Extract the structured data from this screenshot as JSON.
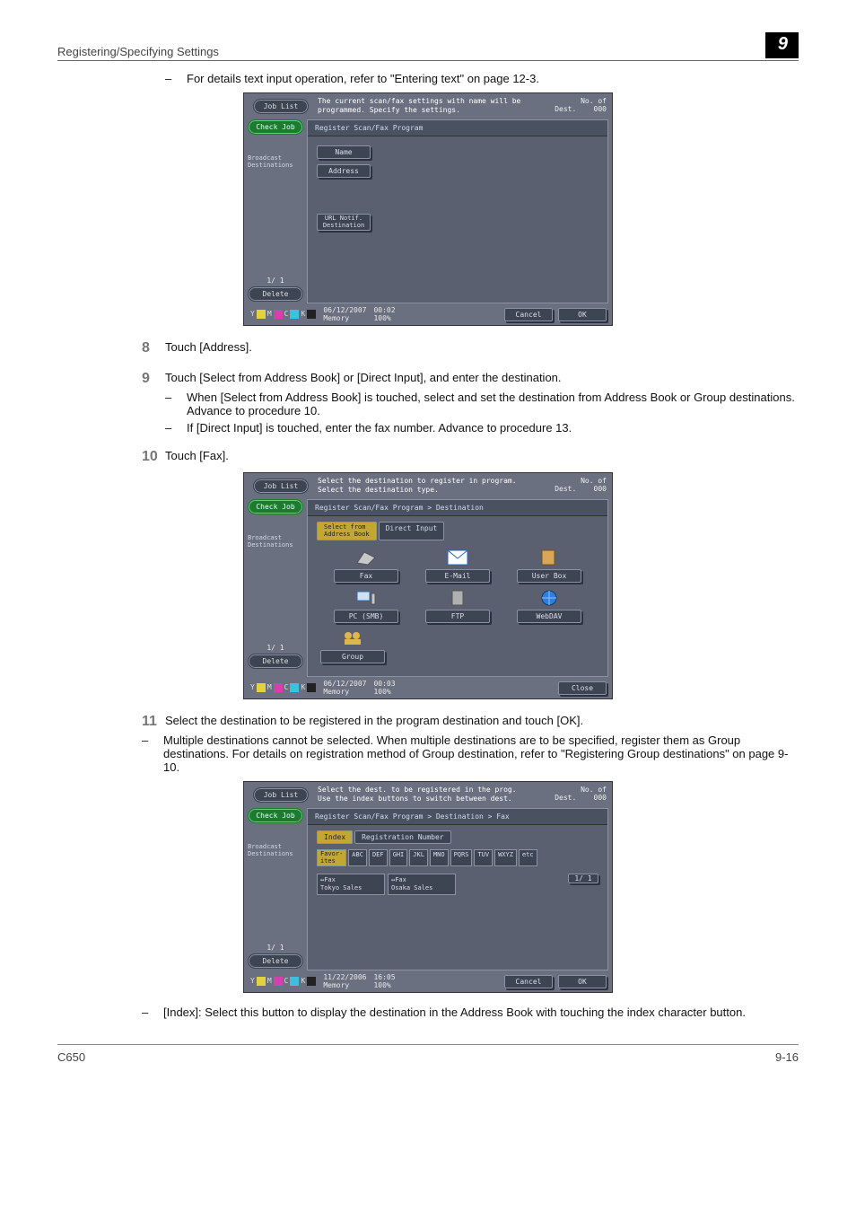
{
  "header": {
    "section_title": "Registering/Specifying Settings",
    "chapter_number": "9"
  },
  "intro_bullet": "For details text input operation, refer to \"Entering text\" on page 12-3.",
  "screen1": {
    "job_list": "Job List",
    "check_job": "Check Job",
    "broadcast": "Broadcast\nDestinations",
    "pager": "1/  1",
    "delete": "Delete",
    "message": "The current scan/fax settings with name will be programmed. Specify the settings.",
    "count_label": "No. of\nDest.",
    "count_value": "000",
    "crumb": "Register Scan/Fax Program",
    "name_btn": "Name",
    "address_btn": "Address",
    "url_btn": "URL Notif.\nDestination",
    "date": "06/12/2007",
    "memory": "Memory",
    "time": "00:02",
    "mem_pct": "100%",
    "cancel": "Cancel",
    "ok": "OK"
  },
  "step8": {
    "num": "8",
    "text": "Touch [Address]."
  },
  "step9": {
    "num": "9",
    "text": "Touch [Select from Address Book] or [Direct Input], and enter the destination.",
    "sub1": "When [Select from Address Book] is touched, select and set the destination from Address Book or Group destinations. Advance to procedure 10.",
    "sub2": "If [Direct Input] is touched, enter the fax number. Advance to procedure 13."
  },
  "step10": {
    "num": "10",
    "text": "Touch [Fax]."
  },
  "screen2": {
    "message": "Select the destination to register in program.\nSelect the destination type.",
    "crumb": "Register Scan/Fax Program > Destination",
    "sel_from": "Select from\nAddress Book",
    "direct": "Direct Input",
    "fax": "Fax",
    "email": "E-Mail",
    "userbox": "User Box",
    "pcsmb": "PC (SMB)",
    "ftp": "FTP",
    "webdav": "WebDAV",
    "group": "Group",
    "date": "06/12/2007",
    "time": "00:03",
    "mem_pct": "100%",
    "close": "Close"
  },
  "step11": {
    "num": "11",
    "text": "Select the destination to be registered in the program destination and touch [OK].",
    "sub1": "Multiple destinations cannot be selected. When multiple destinations are to be specified, register them as Group destinations. For details on registration method of Group destination, refer to \"Registering Group destinations\" on page 9-10."
  },
  "screen3": {
    "message": "Select the dest. to be registered in the prog.\nUse the index buttons to switch between dest.",
    "crumb": "Register Scan/Fax Program > Destination > Fax",
    "tab_index": "Index",
    "tab_regnum": "Registration Number",
    "idx": [
      "Favor-\nites",
      "ABC",
      "DEF",
      "GHI",
      "JKL",
      "MNO",
      "PQRS",
      "TUV",
      "WXYZ",
      "etc"
    ],
    "dest1_type": "↔Fax",
    "dest1_name": "Tokyo Sales",
    "dest2_type": "↔Fax",
    "dest2_name": "Osaka Sales",
    "right_pager": "1/  1",
    "date": "11/22/2006",
    "time": "16:05",
    "mem_pct": "100%",
    "cancel": "Cancel",
    "ok": "OK"
  },
  "post_bullet": "[Index]: Select this button to display the destination in the Address Book with touching the index character button.",
  "footer": {
    "left": "C650",
    "right": "9-16"
  }
}
